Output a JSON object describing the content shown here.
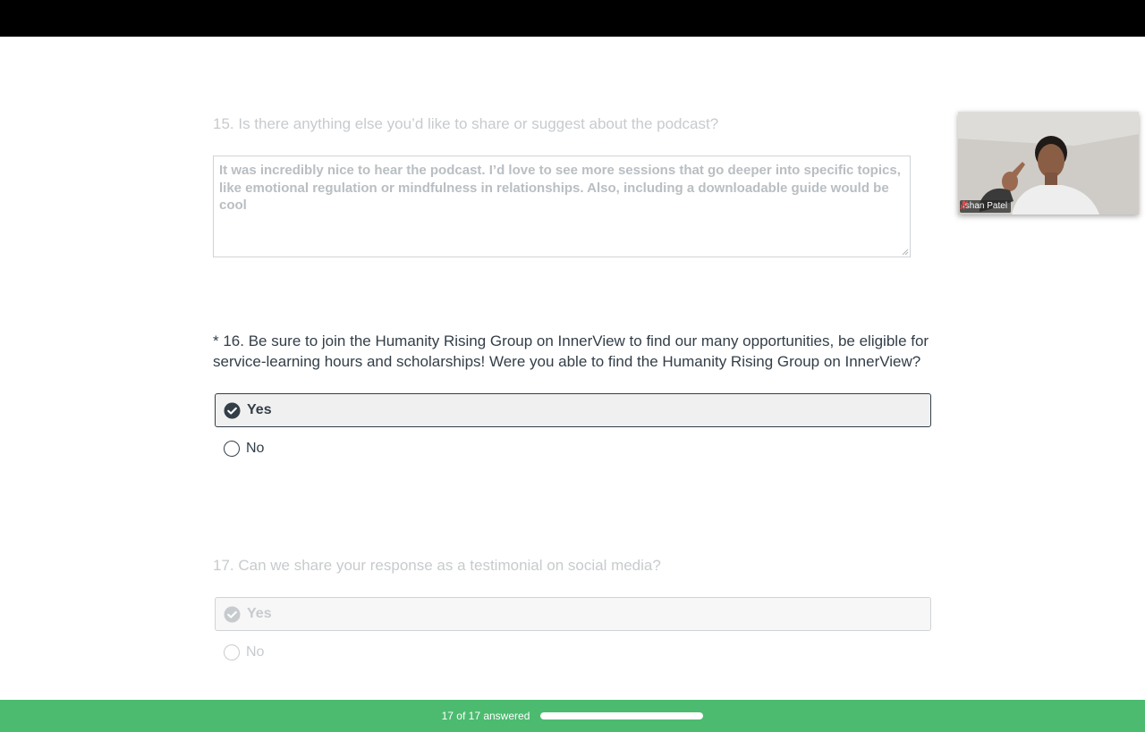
{
  "q15": {
    "title": "15. Is there anything else you’d like to share or suggest about the podcast?",
    "answer": "It was incredibly nice to hear the podcast. I’d love to see more sessions that go deeper into specific topics, like emotional regulation or mindfulness in relationships. Also, including a downloadable guide would be cool"
  },
  "q16": {
    "title": "* 16. Be sure to join the Humanity Rising Group on InnerView to find our many opportunities, be eligible for service-learning hours and scholarships! Were you able to find the Humanity Rising Group on InnerView?",
    "options": [
      {
        "label": "Yes",
        "selected": true
      },
      {
        "label": "No",
        "selected": false
      }
    ]
  },
  "q17": {
    "title": "17. Can we share your response as a testimonial on social media?",
    "options": [
      {
        "label": "Yes",
        "selected": true
      },
      {
        "label": "No",
        "selected": false
      }
    ]
  },
  "video": {
    "participant_name": "Ishan Patel",
    "mic": "muted-mic-icon"
  },
  "footer": {
    "progress_text": "17 of 17 answered",
    "progress_fraction": 1.0
  },
  "colors": {
    "accent_green": "#4cbb6f",
    "text_dark": "#333e48",
    "text_faded": "#c7cbce"
  }
}
